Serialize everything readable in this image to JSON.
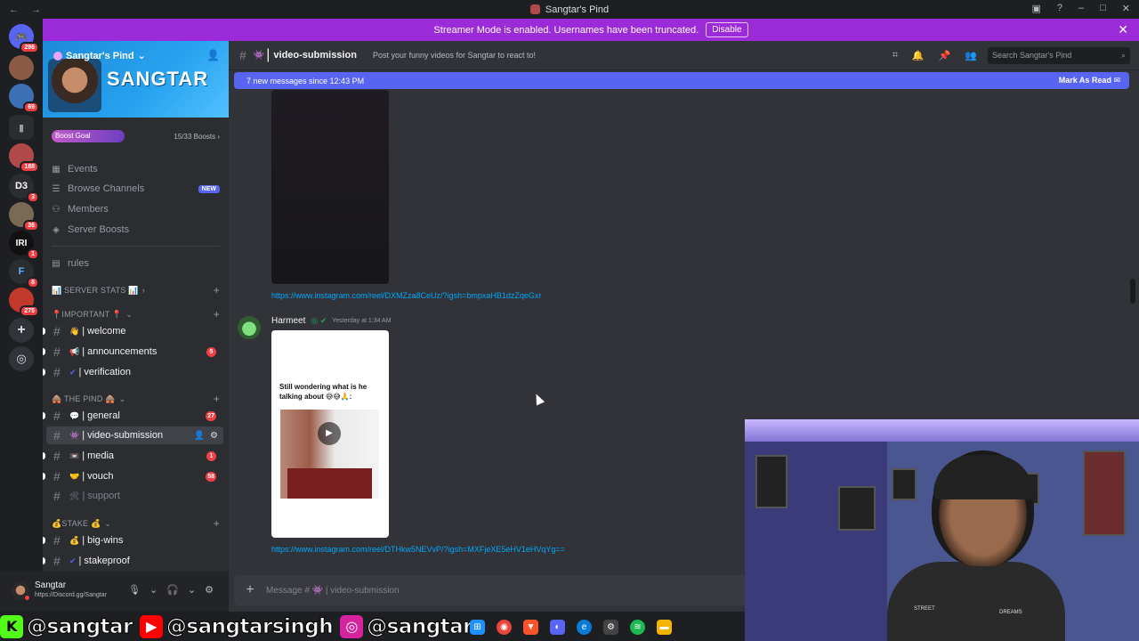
{
  "window": {
    "title": "Sangtar's Pind"
  },
  "rail": {
    "servers": [
      {
        "name": "discord-home",
        "glyph": "⌂",
        "badge": "296",
        "color": "#5865f2"
      },
      {
        "name": "server-2",
        "glyph": "",
        "badge": "",
        "color": "#8a5a44"
      },
      {
        "name": "server-3",
        "glyph": "",
        "badge": "69",
        "color": "#3d6fb5"
      },
      {
        "name": "folder",
        "glyph": "▮",
        "badge": "",
        "color": "#2b2d31"
      },
      {
        "name": "server-5",
        "glyph": "",
        "badge": "188",
        "color": "#b04a4a"
      },
      {
        "name": "server-d3",
        "glyph": "D3",
        "badge": "3",
        "color": "#2b2d31"
      },
      {
        "name": "server-7",
        "glyph": "",
        "badge": "36",
        "color": "#7a6a55"
      },
      {
        "name": "server-iri",
        "glyph": "IRI",
        "badge": "1",
        "color": "#111"
      },
      {
        "name": "server-f",
        "glyph": "F",
        "badge": "8",
        "color": "#2b2d31"
      },
      {
        "name": "server-10",
        "glyph": "",
        "badge": "275",
        "color": "#c0392b"
      },
      {
        "name": "add-server",
        "glyph": "+",
        "badge": "",
        "color": "#313338"
      },
      {
        "name": "discover",
        "glyph": "◎",
        "badge": "",
        "color": "#313338"
      }
    ]
  },
  "banner": {
    "text": "Streamer Mode is enabled. Usernames have been truncated.",
    "button": "Disable"
  },
  "guild": {
    "name": "Sangtar's Pind",
    "brand": "SANGTAR",
    "boost_goal": "Boost Goal",
    "boost_count": "15/33 Boosts"
  },
  "menu": [
    {
      "icon": "calendar-icon",
      "glyph": "▦",
      "label": "Events",
      "new": ""
    },
    {
      "icon": "browse-icon",
      "glyph": "☰",
      "label": "Browse Channels",
      "new": "NEW"
    },
    {
      "icon": "members-icon",
      "glyph": "👥",
      "label": "Members",
      "new": ""
    },
    {
      "icon": "boost-icon",
      "glyph": "◈",
      "label": "Server Boosts",
      "new": ""
    }
  ],
  "rules": {
    "label": "rules"
  },
  "categories": {
    "server_stats": "📊 SERVER STATS 📊",
    "important": "📍IMPORTANT 📍",
    "the_pind": "🛖 The Pind 🛖",
    "stake": "💰Stake 💰"
  },
  "channels": {
    "welcome": {
      "emoji": "👋",
      "name": "welcome",
      "badge": ""
    },
    "announcements": {
      "emoji": "📢",
      "name": "announcements",
      "badge": "5"
    },
    "verification": {
      "emoji": "✔",
      "name": "verification",
      "badge": ""
    },
    "general": {
      "emoji": "💬",
      "name": "general",
      "badge": "27"
    },
    "video_submission": {
      "emoji": "👾",
      "name": "video-submission",
      "badge": ""
    },
    "media": {
      "emoji": "📼",
      "name": "media",
      "badge": "1"
    },
    "vouch": {
      "emoji": "🤝",
      "name": "vouch",
      "badge": "58"
    },
    "support": {
      "emoji": "🛠",
      "name": "support",
      "badge": ""
    },
    "big_wins": {
      "emoji": "💰",
      "name": "big-wins",
      "badge": ""
    },
    "stakeproof": {
      "emoji": "✔",
      "name": "stakeproof",
      "badge": ""
    }
  },
  "user": {
    "name": "Sangtar",
    "sub": "https://Discord.gg/Sangtar"
  },
  "header": {
    "channel": "video-submission",
    "emoji": "👾",
    "topic": "Post your funny videos for Sangtar to react to!",
    "search_placeholder": "Search Sangtar's Pind"
  },
  "chat": {
    "new_messages": "7 new messages since 12:43 PM",
    "mark_read": "Mark As Read",
    "link1": "https://www.instagram.com/reel/DXMZza8CeUz/?igsh=bmpxaHB1dzZqeGxr",
    "author": "Harmeet",
    "timestamp": "Yesterday at 1:34 AM",
    "card_caption": "Still wondering what is he talking about 😅😅🙏:",
    "link2": "https://www.instagram.com/reel/DTHkw5NEVvP/?igsh=MXFjeXE5eHV1eHVqYg=="
  },
  "composer": {
    "placeholder": "Message # 👾 | video-submission"
  },
  "socials": {
    "kick": "@sangtar",
    "youtube": "@sangtarsingh",
    "instagram": "@sangtarr"
  },
  "webcam": {
    "shirt_left": "STREET",
    "shirt_right": "DREAMS"
  }
}
